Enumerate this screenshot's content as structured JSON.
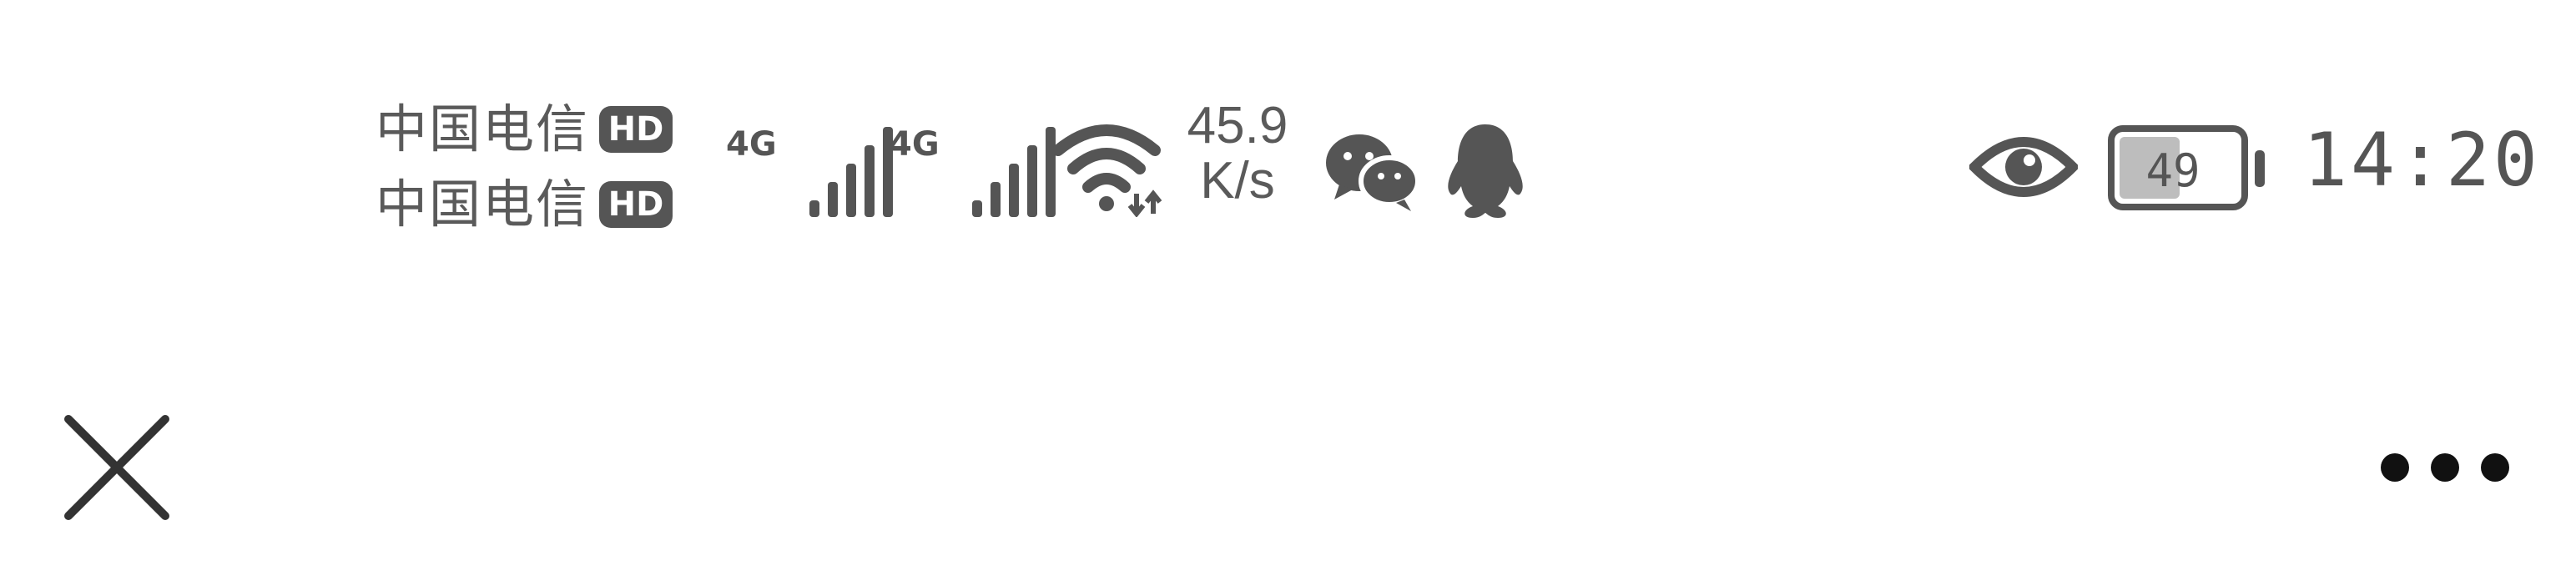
{
  "status_bar": {
    "carriers": [
      {
        "name": "中国电信",
        "badge": "HD"
      },
      {
        "name": "中国电信",
        "badge": "HD"
      }
    ],
    "signals": [
      {
        "network": "4G",
        "icon": "signal-bars-icon"
      },
      {
        "network": "4G",
        "icon": "signal-bars-icon"
      }
    ],
    "wifi_icon": "wifi-icon",
    "network_speed": {
      "value": "45.9",
      "unit": "K/s"
    },
    "notification_icons": [
      "wechat-icon",
      "qq-icon"
    ],
    "eye_comfort_icon": "eye-icon",
    "battery": {
      "level": "49",
      "icon": "battery-icon"
    },
    "time": "14:20"
  },
  "action_bar": {
    "close_icon": "close-icon",
    "more_icon": "more-dots-icon"
  },
  "colors": {
    "icon": "#555555",
    "background": "#ffffff",
    "battery_fill": "#bdbdbd"
  }
}
